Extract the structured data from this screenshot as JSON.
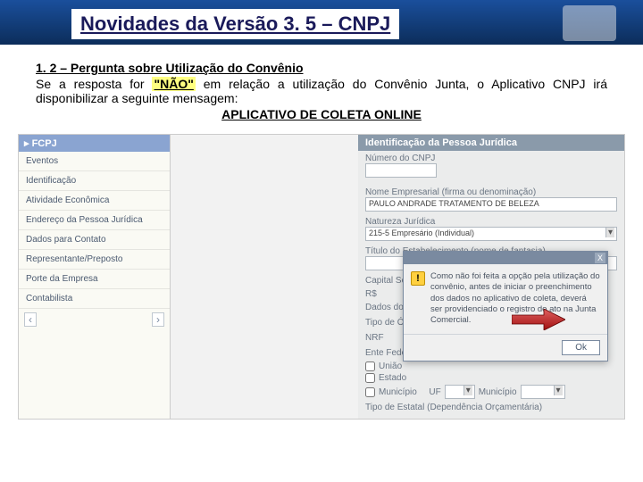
{
  "header": {
    "title": "Novidades da Versão 3. 5 – CNPJ"
  },
  "intro": {
    "section_title": "1. 2 – Pergunta sobre Utilização do Convênio",
    "pre": "Se a resposta for ",
    "nao": "\"NÃO\"",
    "post": " em relação a utilização do Convênio Junta, o Aplicativo CNPJ irá disponibilizar a seguinte mensagem:",
    "app_name": "APLICATIVO DE COLETA ONLINE"
  },
  "sidebar": {
    "section": "FCPJ",
    "items": [
      "Eventos",
      "Identificação",
      "Atividade Econômica",
      "Endereço da Pessoa Jurídica",
      "Dados para Contato",
      "Representante/Preposto",
      "Porte da Empresa",
      "Contabilista"
    ],
    "back_icon": "‹",
    "fwd_icon": "›"
  },
  "form": {
    "panel_title": "Identificação da Pessoa Jurídica",
    "cnpj_label": "Número do CNPJ",
    "nome_label": "Nome Empresarial (firma ou denominação)",
    "nome_value": "PAULO ANDRADE TRATAMENTO DE BELEZA",
    "nj_label": "Natureza Jurídica",
    "nj_value": "215-5   Empresário (Individual)",
    "titulo_label": "Título do Estabelecimento (nome de fantasia)",
    "capital_label": "Capital Social",
    "rs_label": "R$",
    "dados_label": "Dados do",
    "tipo_org": "Tipo de Ó",
    "nrf": "NRF",
    "ente_label": "Ente Federativo",
    "uniao": "União",
    "estado": "Estado",
    "municipio": "Município",
    "uf": "UF",
    "mun2": "Município",
    "tipo_estatal": "Tipo de Estatal (Dependência Orçamentária)"
  },
  "modal": {
    "text": "Como não foi feita a opção pela utilização do convênio, antes de iniciar o preenchimento dos dados no aplicativo de coleta, deverá ser providenciado o registro do ato na Junta Comercial.",
    "ok": "Ok",
    "warn": "!",
    "close": "X"
  }
}
